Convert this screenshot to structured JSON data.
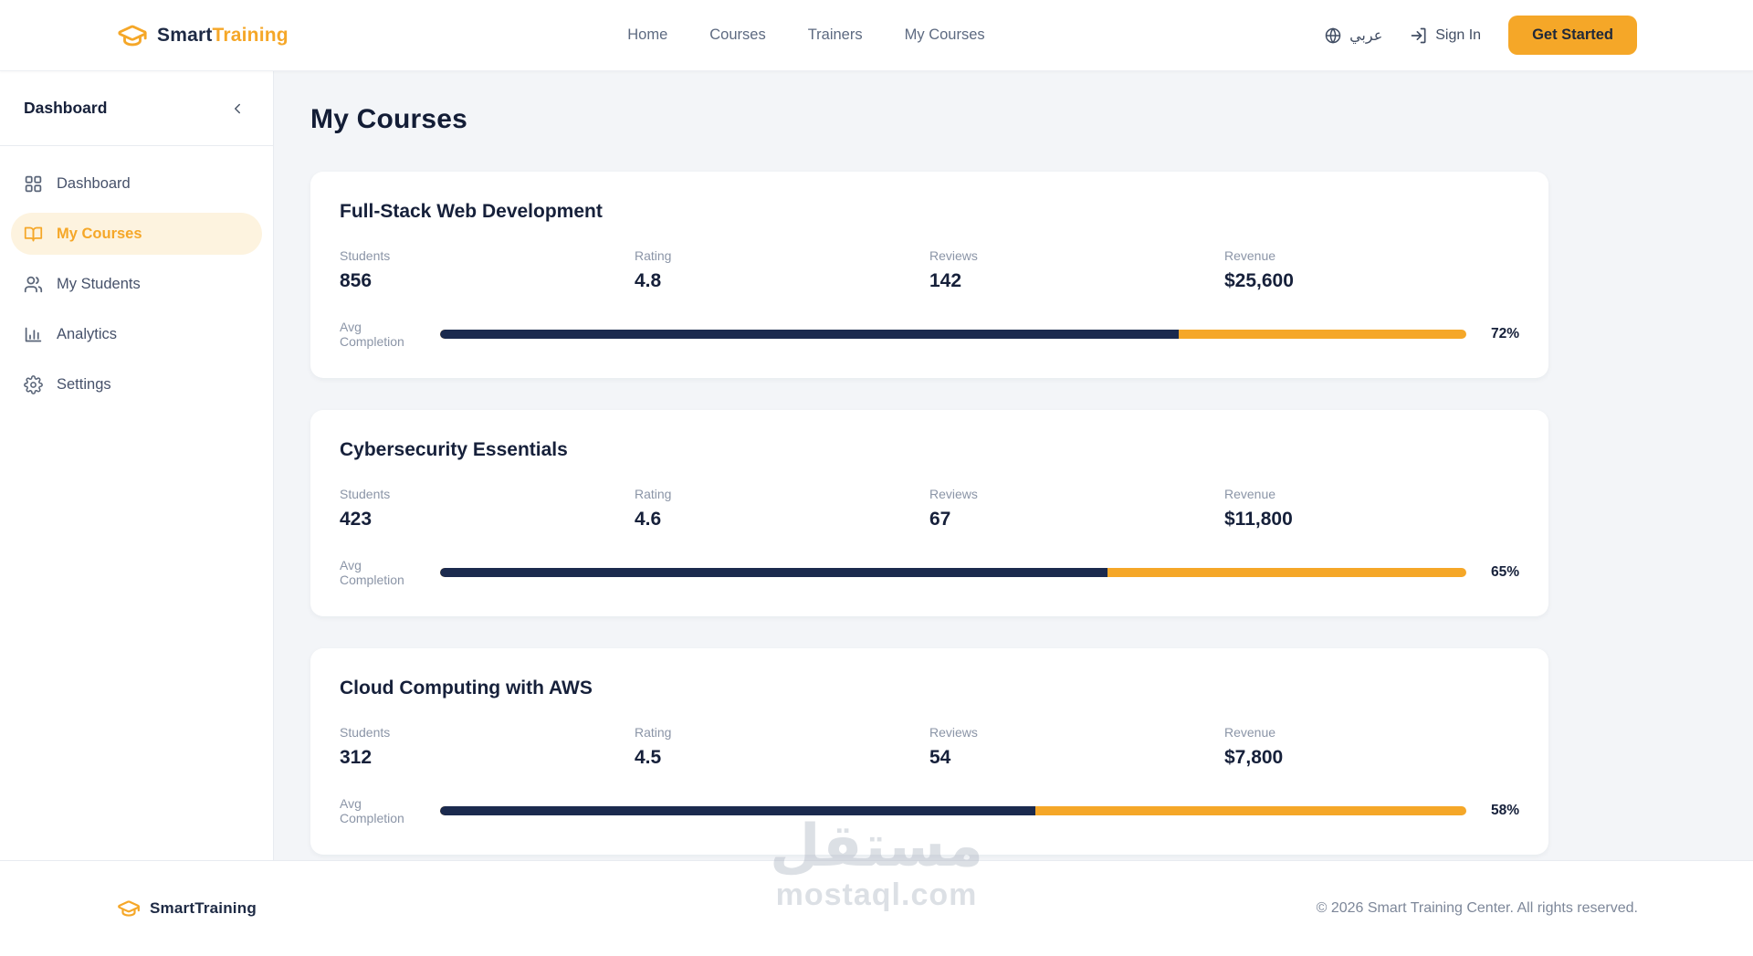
{
  "brand": {
    "name_primary": "Smart",
    "name_secondary": "Training"
  },
  "navbar": {
    "links": [
      {
        "label": "Home"
      },
      {
        "label": "Courses"
      },
      {
        "label": "Trainers"
      },
      {
        "label": "My Courses"
      }
    ],
    "language_label": "عربي",
    "sign_in_label": "Sign In",
    "get_started_label": "Get Started"
  },
  "sidebar": {
    "title": "Dashboard",
    "items": [
      {
        "label": "Dashboard",
        "icon": "grid-icon",
        "active": false
      },
      {
        "label": "My Courses",
        "icon": "book-icon",
        "active": true
      },
      {
        "label": "My Students",
        "icon": "users-icon",
        "active": false
      },
      {
        "label": "Analytics",
        "icon": "bar-chart-icon",
        "active": false
      },
      {
        "label": "Settings",
        "icon": "gear-icon",
        "active": false
      }
    ]
  },
  "main": {
    "title": "My Courses",
    "cards": [
      {
        "title": "Full-Stack Web Development",
        "stats": [
          {
            "label": "Students",
            "value": "856"
          },
          {
            "label": "Rating",
            "value": "4.8"
          },
          {
            "label": "Reviews",
            "value": "142"
          },
          {
            "label": "Revenue",
            "value": "$25,600"
          }
        ],
        "completion_label": "Avg Completion",
        "completion_pct": 72,
        "completion_text": "72%"
      },
      {
        "title": "Cybersecurity Essentials",
        "stats": [
          {
            "label": "Students",
            "value": "423"
          },
          {
            "label": "Rating",
            "value": "4.6"
          },
          {
            "label": "Reviews",
            "value": "67"
          },
          {
            "label": "Revenue",
            "value": "$11,800"
          }
        ],
        "completion_label": "Avg Completion",
        "completion_pct": 65,
        "completion_text": "65%"
      },
      {
        "title": "Cloud Computing with AWS",
        "stats": [
          {
            "label": "Students",
            "value": "312"
          },
          {
            "label": "Rating",
            "value": "4.5"
          },
          {
            "label": "Reviews",
            "value": "54"
          },
          {
            "label": "Revenue",
            "value": "$7,800"
          }
        ],
        "completion_label": "Avg Completion",
        "completion_pct": 58,
        "completion_text": "58%"
      }
    ]
  },
  "footer": {
    "brand_primary": "Smart",
    "brand_secondary": "Training",
    "copyright": "© 2026 Smart Training Center. All rights reserved."
  },
  "watermark": {
    "arabic": "مستقل",
    "latin": "mostaql.com"
  },
  "colors": {
    "accent_orange": "#F5A728",
    "bar_navy": "#1B2A4E",
    "active_pill_bg": "#FDF3DF",
    "page_bg": "#F3F5F8"
  }
}
